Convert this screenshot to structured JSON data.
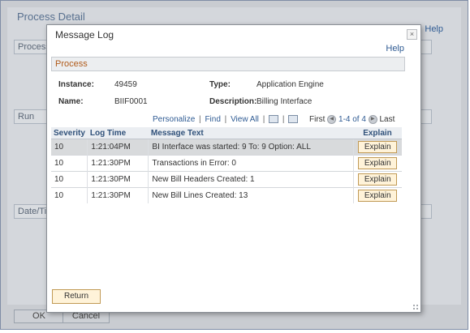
{
  "background": {
    "title": "Process Detail",
    "help_label": "Help",
    "sections": [
      "Process",
      "Run",
      "Date/Tim"
    ],
    "ok_label": "OK",
    "cancel_label": "Cancel"
  },
  "modal": {
    "title": "Message Log",
    "close_symbol": "×",
    "help_label": "Help",
    "section_title": "Process",
    "fields": {
      "instance_label": "Instance:",
      "instance_value": "49459",
      "type_label": "Type:",
      "type_value": "Application Engine",
      "name_label": "Name:",
      "name_value": "BIIF0001",
      "description_label": "Description:",
      "description_value": "Billing Interface"
    },
    "toolbar": {
      "personalize": "Personalize",
      "find": "Find",
      "view_all": "View All",
      "first": "First",
      "range": "1-4 of 4",
      "last": "Last"
    },
    "grid": {
      "headers": [
        "Severity",
        "Log Time",
        "Message Text",
        "Explain"
      ],
      "rows": [
        {
          "severity": "10",
          "time": "1:21:04PM",
          "message": "BI Interface was started: 9 To: 9  Option: ALL",
          "explain": "Explain"
        },
        {
          "severity": "10",
          "time": "1:21:30PM",
          "message": "Transactions in Error: 0",
          "explain": "Explain"
        },
        {
          "severity": "10",
          "time": "1:21:30PM",
          "message": "New Bill Headers Created:  1",
          "explain": "Explain"
        },
        {
          "severity": "10",
          "time": "1:21:30PM",
          "message": "New Bill Lines Created: 13",
          "explain": "Explain"
        }
      ]
    },
    "return_label": "Return"
  }
}
